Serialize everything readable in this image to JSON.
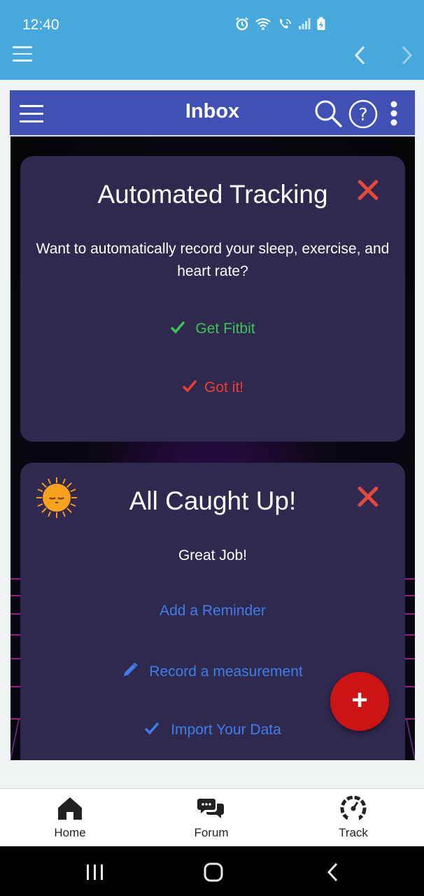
{
  "status_bar": {
    "time": "12:40"
  },
  "app_header": {
    "title": "Inbox"
  },
  "cards": [
    {
      "title": "Automated Tracking",
      "message": "Want to automatically record your sleep, exercise, and heart rate?",
      "actions": [
        {
          "label": "Get Fitbit",
          "icon": "check-icon",
          "color": "#3bc456"
        },
        {
          "label": "Got it!",
          "icon": "check-icon",
          "color": "#ee3e33"
        }
      ]
    },
    {
      "title": "All Caught Up!",
      "message": "Great Job!",
      "actions": [
        {
          "label": "Add a Reminder",
          "icon": "",
          "color": "#3f7ee8"
        },
        {
          "label": "Record a measurement",
          "icon": "pencil-icon",
          "color": "#3f7ee8"
        },
        {
          "label": "Import Your Data",
          "icon": "check-icon",
          "color": "#3f7ee8"
        }
      ]
    }
  ],
  "fab": {
    "label": "+"
  },
  "bottom_nav": {
    "tabs": [
      {
        "label": "Home",
        "icon": "home-icon"
      },
      {
        "label": "Forum",
        "icon": "chat-bubbles-icon"
      },
      {
        "label": "Track",
        "icon": "gauge-icon"
      }
    ]
  },
  "colors": {
    "browser_bar": "#47a8de",
    "app_header": "#3f51b5",
    "card_bg": "#30294f",
    "close": "#e8473e",
    "fab": "#cc1414"
  }
}
